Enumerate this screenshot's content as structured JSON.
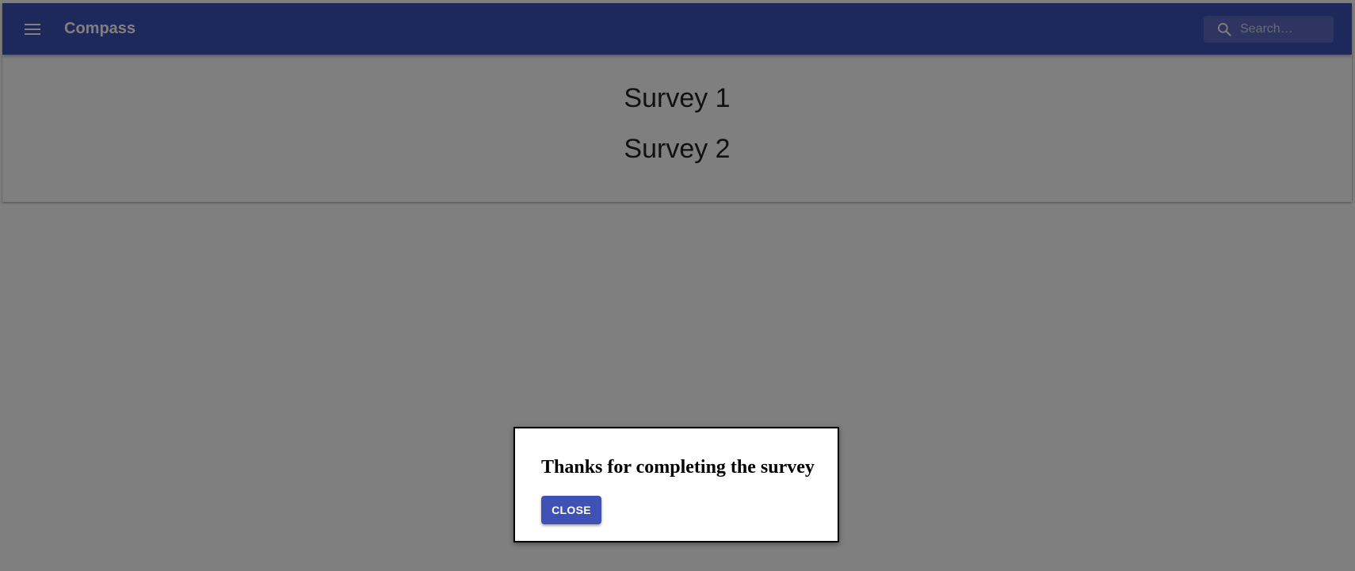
{
  "app_bar": {
    "title": "Compass",
    "menu_icon": "hamburger-menu-icon",
    "search": {
      "icon": "search-icon",
      "placeholder": "Search…",
      "value": ""
    }
  },
  "surveys": {
    "items": [
      {
        "label": "Survey 1"
      },
      {
        "label": "Survey 2"
      }
    ]
  },
  "dialog": {
    "message": "Thanks for completing the survey",
    "close_label": "CLOSE"
  },
  "colors": {
    "primary": "#3f51b5",
    "overlay": "rgba(0,0,0,0.5)"
  }
}
